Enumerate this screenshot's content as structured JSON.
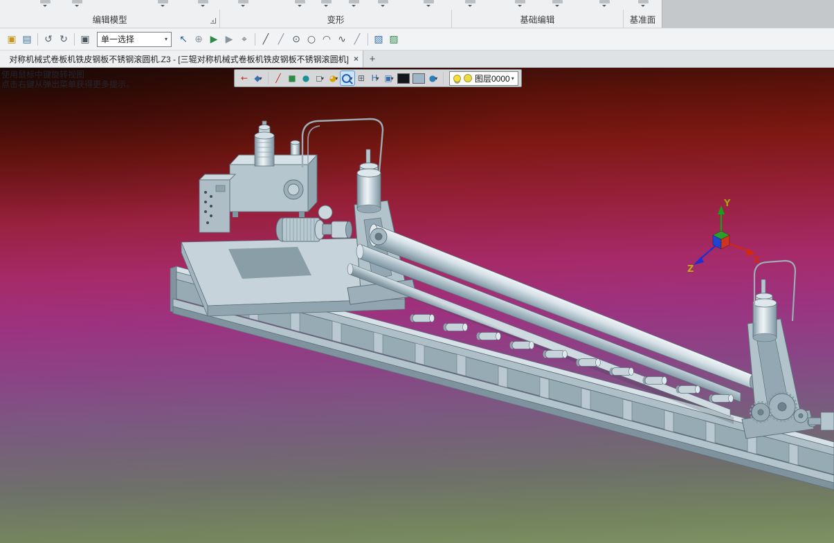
{
  "ribbon": {
    "groups": [
      {
        "label": "编辑模型"
      },
      {
        "label": "变形"
      },
      {
        "label": "基础编辑"
      },
      {
        "label": "基准面"
      }
    ]
  },
  "quick_toolbar": {
    "select_mode_value": "单一选择",
    "combo_arrow": "▾",
    "icons_left": [
      {
        "type": "icon",
        "name": "open-file-icon",
        "glyph": "▣",
        "color": "#c9941a"
      },
      {
        "type": "icon",
        "name": "import-file-icon",
        "glyph": "▤",
        "color": "#3a6fb0"
      },
      {
        "type": "sep"
      },
      {
        "type": "icon",
        "name": "undo-icon",
        "glyph": "↺",
        "color": "#55606a"
      },
      {
        "type": "icon",
        "name": "redo-icon",
        "glyph": "↻",
        "color": "#55606a"
      },
      {
        "type": "sep"
      },
      {
        "type": "icon",
        "name": "selection-box-icon",
        "glyph": "▣",
        "color": "#4a545c"
      }
    ],
    "icons_right": [
      {
        "type": "icon",
        "name": "pick-arrow-icon",
        "glyph": "↖",
        "color": "#2a5caa"
      },
      {
        "type": "icon",
        "name": "pick-filter-icon",
        "glyph": "⊕",
        "color": "#8a949c"
      },
      {
        "type": "icon",
        "name": "play-icon",
        "glyph": "▶",
        "color": "#2f8a4a"
      },
      {
        "type": "icon",
        "name": "replay-icon",
        "glyph": "▶",
        "color": "#8a949c"
      },
      {
        "type": "icon",
        "name": "point-snap-icon",
        "glyph": "⌖",
        "color": "#55606a"
      },
      {
        "type": "sep"
      },
      {
        "type": "icon",
        "name": "line-icon",
        "glyph": "╱",
        "color": "#4a545c"
      },
      {
        "type": "icon",
        "name": "polyline-icon",
        "glyph": "╱",
        "color": "#8a949c"
      },
      {
        "type": "icon",
        "name": "circle-center-icon",
        "glyph": "⊙",
        "color": "#4a545c"
      },
      {
        "type": "icon",
        "name": "circle-icon",
        "glyph": "○",
        "color": "#4a545c"
      },
      {
        "type": "icon",
        "name": "arc-icon",
        "glyph": "◠",
        "color": "#4a545c"
      },
      {
        "type": "icon",
        "name": "spline-icon",
        "glyph": "∿",
        "color": "#4a545c"
      },
      {
        "type": "icon",
        "name": "slash-icon",
        "glyph": "╱",
        "color": "#8a949c"
      },
      {
        "type": "sep"
      },
      {
        "type": "icon",
        "name": "layer-sheet-icon",
        "glyph": "▧",
        "color": "#3a6fb0"
      },
      {
        "type": "icon",
        "name": "layer-sheet2-icon",
        "glyph": "▨",
        "color": "#2f8a4a"
      }
    ]
  },
  "tab_bar": {
    "tab_title": "对称机械式卷板机铁皮钢板不锈钢滚圆机.Z3 - [三辊对称机械式卷板机铁皮钢板不锈钢滚圆机]",
    "close_glyph": "×",
    "new_tab_glyph": "+"
  },
  "viewport": {
    "hint_line1": "使用鼠标中键旋转视图",
    "hint_line2": "点击右键从弹出菜单获得更多提示。",
    "toolbar": {
      "items": [
        {
          "type": "icon",
          "name": "exit-environment-icon",
          "glyph": "←",
          "color": "#c22514"
        },
        {
          "type": "icon",
          "name": "view-orientation-icon",
          "glyph": "◆",
          "color": "#3a6fb0",
          "dropdown": true
        },
        {
          "type": "sep"
        },
        {
          "type": "icon",
          "name": "sketch-mode-icon",
          "glyph": "╱",
          "color": "#c22514"
        },
        {
          "type": "icon",
          "name": "shaded-display-icon",
          "glyph": "■",
          "color": "#2f8a4a"
        },
        {
          "type": "icon",
          "name": "sphere-display-icon",
          "glyph": "●",
          "color": "#1d8f96"
        },
        {
          "type": "icon",
          "name": "wireframe-display-icon",
          "glyph": "◻",
          "color": "#55606a",
          "dropdown": true
        },
        {
          "type": "icon",
          "name": "section-view-icon",
          "glyph": "◕",
          "color": "#d9a400",
          "dropdown": true
        },
        {
          "type": "icon",
          "name": "zoom-icon",
          "glyph": "@mag",
          "color": "#1a5fb4",
          "dropdown": true,
          "selected": true
        },
        {
          "type": "icon",
          "name": "zoom-window-icon",
          "glyph": "⊞",
          "color": "#55606a"
        },
        {
          "type": "icon",
          "name": "datum-display-icon",
          "glyph": "H",
          "color": "#3a6fb0",
          "dropdown": true
        },
        {
          "type": "icon",
          "name": "display-settings-icon",
          "glyph": "▣",
          "color": "#3a6fb0",
          "dropdown": true
        },
        {
          "type": "swatch",
          "name": "background-black-swatch",
          "color": "#14161a"
        },
        {
          "type": "swatch",
          "name": "background-blue-swatch",
          "color": "#9fb6c8"
        },
        {
          "type": "icon",
          "name": "render-mode-icon",
          "glyph": "●",
          "color": "#2a7fb8",
          "dropdown": true
        },
        {
          "type": "sep"
        }
      ],
      "layer_combo": {
        "value": "图层0000",
        "arrow": "▾"
      }
    },
    "triad": {
      "x_label": "X",
      "y_label": "Y",
      "z_label": "Z"
    },
    "colors": {
      "bg_top": "#571109",
      "bg_mid": "#a62a68",
      "bg_bottom": "#7e9263",
      "model_light": "#d7e1e7",
      "model_mid": "#aebfc8",
      "model_dark": "#8fa3ad",
      "axis_x": "#d22810",
      "axis_y": "#18a018",
      "axis_z": "#2030d0"
    }
  }
}
